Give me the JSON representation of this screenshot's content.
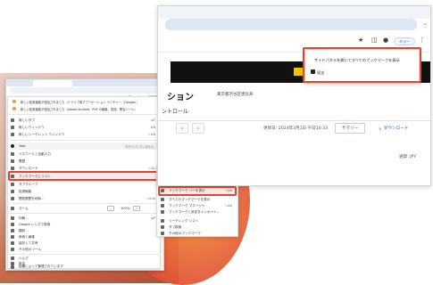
{
  "window": {
    "user_chip": "ネラー",
    "page_title": "ション",
    "page_address": "東京都渋谷区恵比寿",
    "yellow_label": "こち",
    "section_label": "ントロール",
    "updated": "更新日: 2024年3月1日 午前10:33",
    "summary_button": "サマリー",
    "download_button": "ダウンロード",
    "currency": "通貨: JPY",
    "nav_prev": "‹",
    "nav_next": "›"
  },
  "side_popup": {
    "option": "サイドパネルを開いてすべてのブックマークを表示",
    "recent": "収支"
  },
  "small_window": {
    "user_chip": "ネラー",
    "menu": {
      "updates": [
        "新しい拡張機能が追加されました（ドライブ用アプリケーション ランチャー（Google））",
        "新しい拡張機能が追加されました（Adobe Acrobat：PDF の編集、変換、署名ツール）"
      ],
      "items": [
        {
          "label": "新しいタブ",
          "shortcut": "⌘T"
        },
        {
          "label": "新しいウィンドウ",
          "shortcut": "⌘N"
        },
        {
          "label": "新しいシークレット ウィンドウ",
          "shortcut": "⇧⌘N"
        }
      ],
      "profile": {
        "name": "Yato",
        "status": "ログインしていません"
      },
      "profile_items": [
        {
          "label": "パスワードと自動入力"
        },
        {
          "label": "履歴"
        },
        {
          "label": "ダウンロード",
          "shortcut": "⌥⌘L"
        }
      ],
      "bookmarks_item": "ブックマークとリスト",
      "more_items": [
        {
          "label": "タブグループ"
        },
        {
          "label": "拡張機能",
          "shortcut": ""
        },
        {
          "label": "閲覧履歴を削除...",
          "shortcut": "⇧⌘⌫"
        }
      ],
      "zoom_label": "ズーム",
      "zoom_minus": "−",
      "zoom_value": "100%",
      "zoom_plus": "+",
      "tail_items": [
        {
          "label": "印刷...",
          "shortcut": "⌘P"
        },
        {
          "label": "Google レンズで検索"
        },
        {
          "label": "翻訳..."
        },
        {
          "label": "検索と編集"
        },
        {
          "label": "保存して共有"
        },
        {
          "label": "その他のツール"
        },
        {
          "label": "ヘルプ"
        },
        {
          "label": "設定",
          "shortcut": "⌘,"
        },
        {
          "label": "組織によって管理されています"
        }
      ]
    },
    "submenu": [
      {
        "label": "このタブをブックマークに追加...",
        "shortcut": "⌘D"
      },
      {
        "label": "すべてのタブをブックマークに追加...",
        "shortcut": "⇧⌘D"
      },
      {
        "label": "ブックマーク バーを表示",
        "shortcut": "⇧⌘B"
      },
      {
        "label": "すべてのブックマークを表示"
      },
      {
        "label": "ブックマーク マネージャ",
        "shortcut": "⌥⌘B"
      },
      {
        "label": "ブックマークと設定をインポート..."
      },
      {
        "label": "リーディング リスト"
      },
      {
        "label": "タブ検索"
      },
      {
        "label": "その他のブックマーク"
      }
    ]
  },
  "colors": {
    "highlight": "#e0462f",
    "accent": "#1a56c4"
  }
}
